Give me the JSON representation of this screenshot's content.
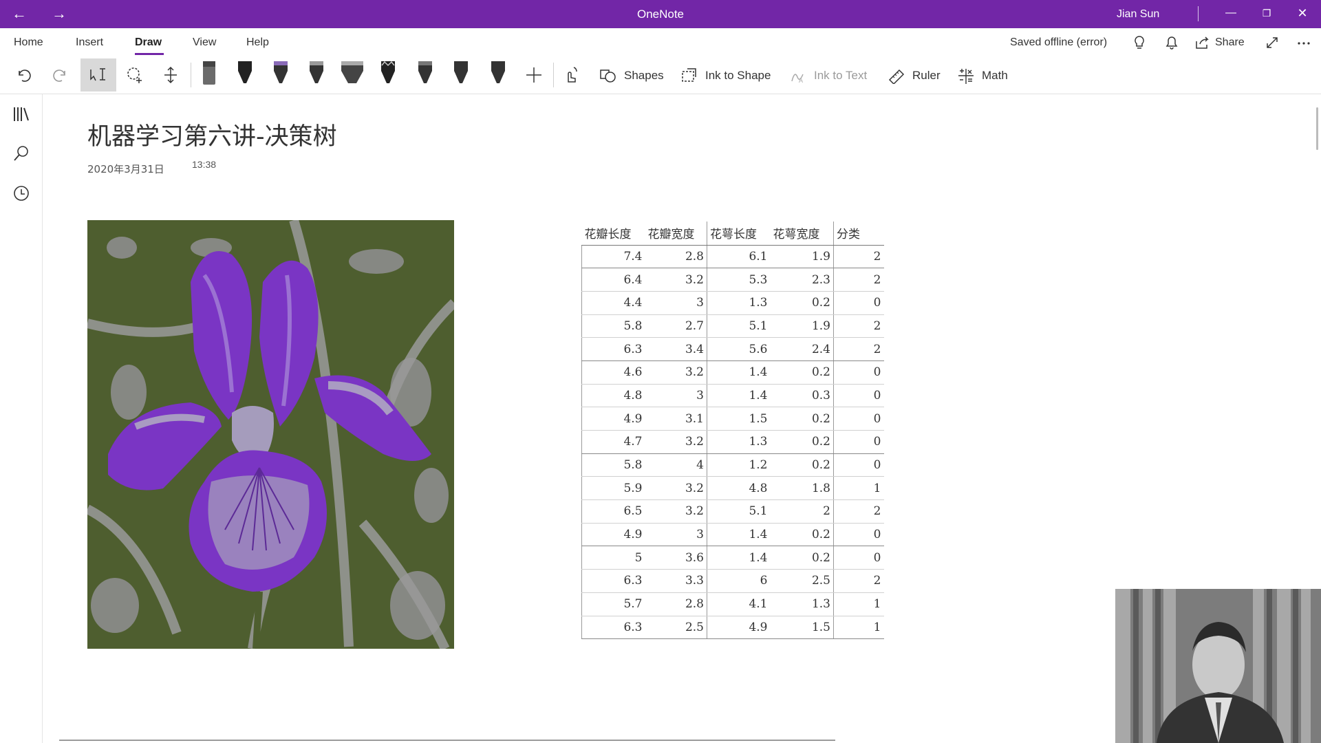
{
  "titlebar": {
    "app_title": "OneNote",
    "user": "Jian Sun",
    "color": "#7226a7"
  },
  "tabs": [
    {
      "label": "Home"
    },
    {
      "label": "Insert"
    },
    {
      "label": "Draw"
    },
    {
      "label": "View"
    },
    {
      "label": "Help"
    }
  ],
  "active_tab": "Draw",
  "header_right": {
    "status": "Saved offline (error)",
    "share_label": "Share"
  },
  "toolbar": {
    "shapes_label": "Shapes",
    "ink_to_shape_label": "Ink to Shape",
    "ink_to_text_label": "Ink to Text",
    "ruler_label": "Ruler",
    "math_label": "Math",
    "pens": [
      {
        "name": "pen-gray",
        "color": "#6b6b6b"
      },
      {
        "name": "pen-black-1",
        "color": "#222222"
      },
      {
        "name": "pen-purple",
        "color": "#8a6bb8"
      },
      {
        "name": "pen-black-2",
        "color": "#333333"
      },
      {
        "name": "highlighter",
        "color": "#444444"
      },
      {
        "name": "pen-zigzag",
        "color": "#222222"
      },
      {
        "name": "pen-black-3",
        "color": "#333333"
      },
      {
        "name": "pen-black-4",
        "color": "#333333"
      },
      {
        "name": "pen-black-5",
        "color": "#333333"
      }
    ]
  },
  "page": {
    "title": "机器学习第六讲-决策树",
    "date": "2020年3月31日",
    "time": "13:38"
  },
  "table": {
    "headers": [
      "花瓣长度",
      "花瓣宽度",
      "花萼长度",
      "花萼宽度",
      "分类"
    ],
    "rows": [
      [
        "7.4",
        "2.8",
        "6.1",
        "1.9",
        "2"
      ],
      [
        "6.4",
        "3.2",
        "5.3",
        "2.3",
        "2"
      ],
      [
        "4.4",
        "3",
        "1.3",
        "0.2",
        "0"
      ],
      [
        "5.8",
        "2.7",
        "5.1",
        "1.9",
        "2"
      ],
      [
        "6.3",
        "3.4",
        "5.6",
        "2.4",
        "2"
      ],
      [
        "4.6",
        "3.2",
        "1.4",
        "0.2",
        "0"
      ],
      [
        "4.8",
        "3",
        "1.4",
        "0.3",
        "0"
      ],
      [
        "4.9",
        "3.1",
        "1.5",
        "0.2",
        "0"
      ],
      [
        "4.7",
        "3.2",
        "1.3",
        "0.2",
        "0"
      ],
      [
        "5.8",
        "4",
        "1.2",
        "0.2",
        "0"
      ],
      [
        "5.9",
        "3.2",
        "4.8",
        "1.8",
        "1"
      ],
      [
        "6.5",
        "3.2",
        "5.1",
        "2",
        "2"
      ],
      [
        "4.9",
        "3",
        "1.4",
        "0.2",
        "0"
      ],
      [
        "5",
        "3.6",
        "1.4",
        "0.2",
        "0"
      ],
      [
        "6.3",
        "3.3",
        "6",
        "2.5",
        "2"
      ],
      [
        "5.7",
        "2.8",
        "4.1",
        "1.3",
        "1"
      ],
      [
        "6.3",
        "2.5",
        "4.9",
        "1.5",
        "1"
      ]
    ]
  }
}
